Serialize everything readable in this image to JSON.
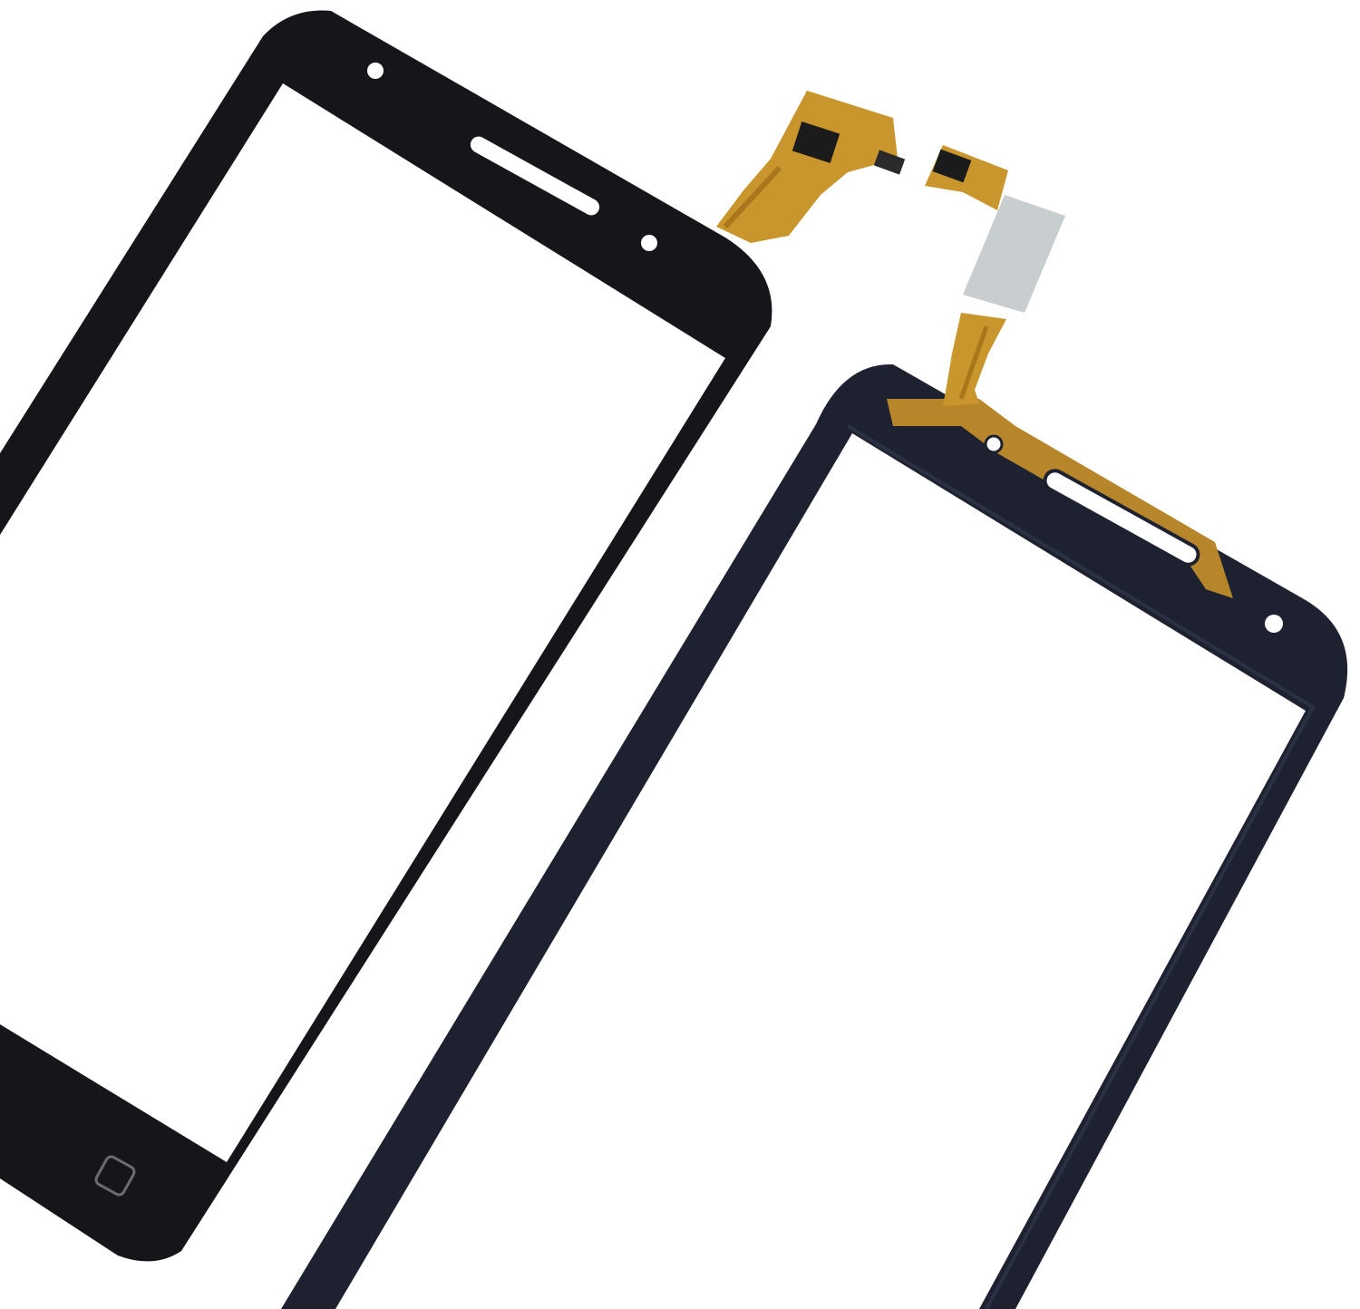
{
  "image": {
    "subject": "",
    "background_color": "#ffffff"
  },
  "colors": {
    "frame_front": "#15161a",
    "frame_back": "#1e2230",
    "flex_cable": "#c9962e",
    "flex_cable_dark": "#a8771c",
    "chip": "#1b1b1b",
    "stiffener": "#c8cdd0",
    "glass": "#ffffff"
  },
  "icons": {
    "home_button": "square-outline-icon",
    "earpiece": "speaker-slot-icon",
    "sensor": "dot-icon"
  }
}
